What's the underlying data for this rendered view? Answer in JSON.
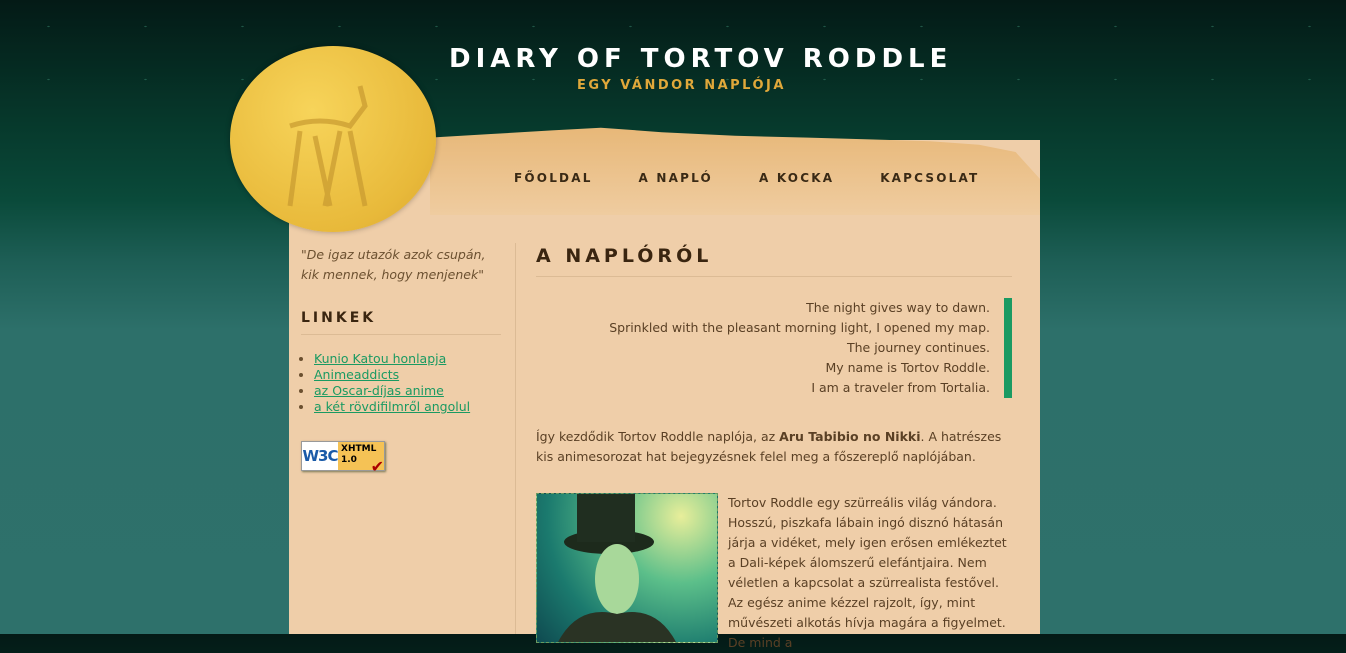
{
  "header": {
    "title": "DIARY OF TORTOV RODDLE",
    "subtitle": "EGY VÁNDOR NAPLÓJA"
  },
  "nav": [
    {
      "label": "FŐOLDAL"
    },
    {
      "label": "A NAPLÓ"
    },
    {
      "label": "A KOCKA"
    },
    {
      "label": "KAPCSOLAT"
    }
  ],
  "sidebar": {
    "quote": "\"De igaz utazók azok csupán, kik mennek, hogy menjenek\"",
    "links_heading": "LINKEK",
    "links": [
      "Kunio Katou honlapja",
      "Animeaddicts",
      "az Oscar-díjas anime",
      "a két rövdifilmről angolul"
    ],
    "badge": {
      "left": "W3C",
      "line1": "XHTML",
      "line2": "1.0"
    }
  },
  "main": {
    "heading": "A NAPLÓRÓL",
    "poem": [
      "The night gives way to dawn.",
      "Sprinkled with the pleasant morning light, I opened my map.",
      "The journey continues.",
      "My name is Tortov Roddle.",
      "I am a traveler from Tortalia."
    ],
    "intro_before": "Így kezdődik Tortov Roddle naplója, az ",
    "intro_bold": "Aru Tabibio no Nikki",
    "intro_after": ". A hatrészes kis animesorozat hat bejegyzésnek felel meg a főszereplő naplójában.",
    "body": "Tortov Roddle egy szürreális világ vándora. Hosszú, piszkafa lábain ingó disznó hátasán járja a vidéket, mely igen erősen emlékeztet a Dali-képek álomszerű elefántjaira. Nem véletlen a kapcsolat a szürrealista festővel. Az egész anime kézzel rajzolt, így, mint művészeti alkotás hívja magára a figyelmet. De mind a"
  },
  "colors": {
    "accent": "#1a9a62",
    "paper": "#efcea9",
    "title_sub": "#e0a83a"
  }
}
